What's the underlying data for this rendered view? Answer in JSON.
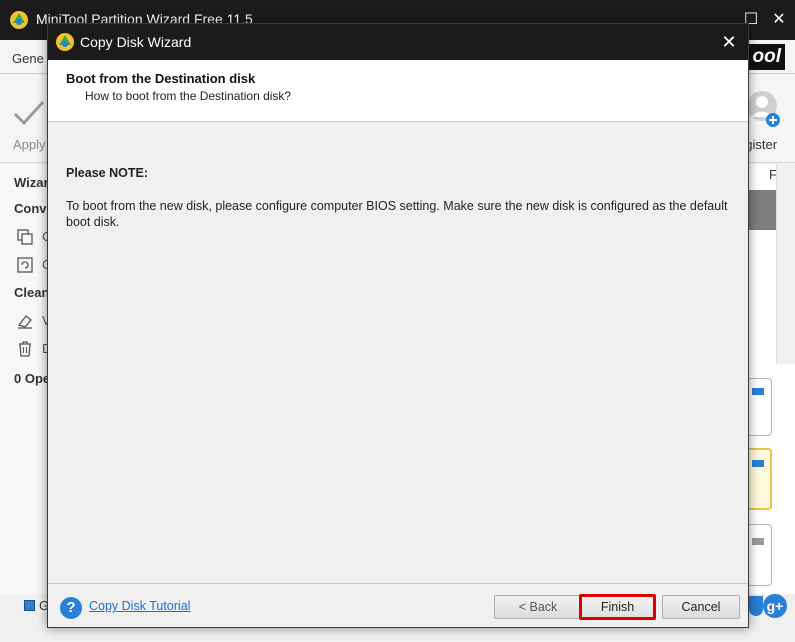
{
  "main_window": {
    "title": "MiniTool Partition Wizard Free 11.5",
    "menu_general": "Gene",
    "brand": "ool",
    "toolbar": {
      "apply_label": "Apply",
      "register_label": "egister"
    },
    "left_pane": {
      "wizard_label": "Wizar",
      "convert_label": "Conv",
      "item1_letter": "C",
      "item2_letter": "C",
      "clean_label": "Clean",
      "item3_letter": "V",
      "item4_letter": "D",
      "operations_label": "0 Ope"
    },
    "right_pane": {
      "header_letter": "F"
    },
    "status": {
      "legend_letter": "G",
      "legend_color": "#2b7fd4"
    }
  },
  "dialog": {
    "title": "Copy Disk Wizard",
    "close_glyph": "✕",
    "step_title": "Boot from the Destination disk",
    "step_subtitle": "How to boot from the Destination disk?",
    "note_title": "Please NOTE:",
    "note_text": "To boot from the new disk, please configure computer BIOS setting. Make sure the new disk is configured as the default boot disk.",
    "help_icon_glyph": "?",
    "tutorial_link": "Copy Disk Tutorial",
    "buttons": {
      "back": "< Back",
      "finish": "Finish",
      "cancel": "Cancel"
    },
    "highlight_color": "#e00000"
  },
  "icons": {
    "app_icon": "minitool-logo-icon",
    "apply_icon": "checkmark-icon",
    "register_icon": "user-add-icon",
    "help_icon": "help-icon"
  }
}
